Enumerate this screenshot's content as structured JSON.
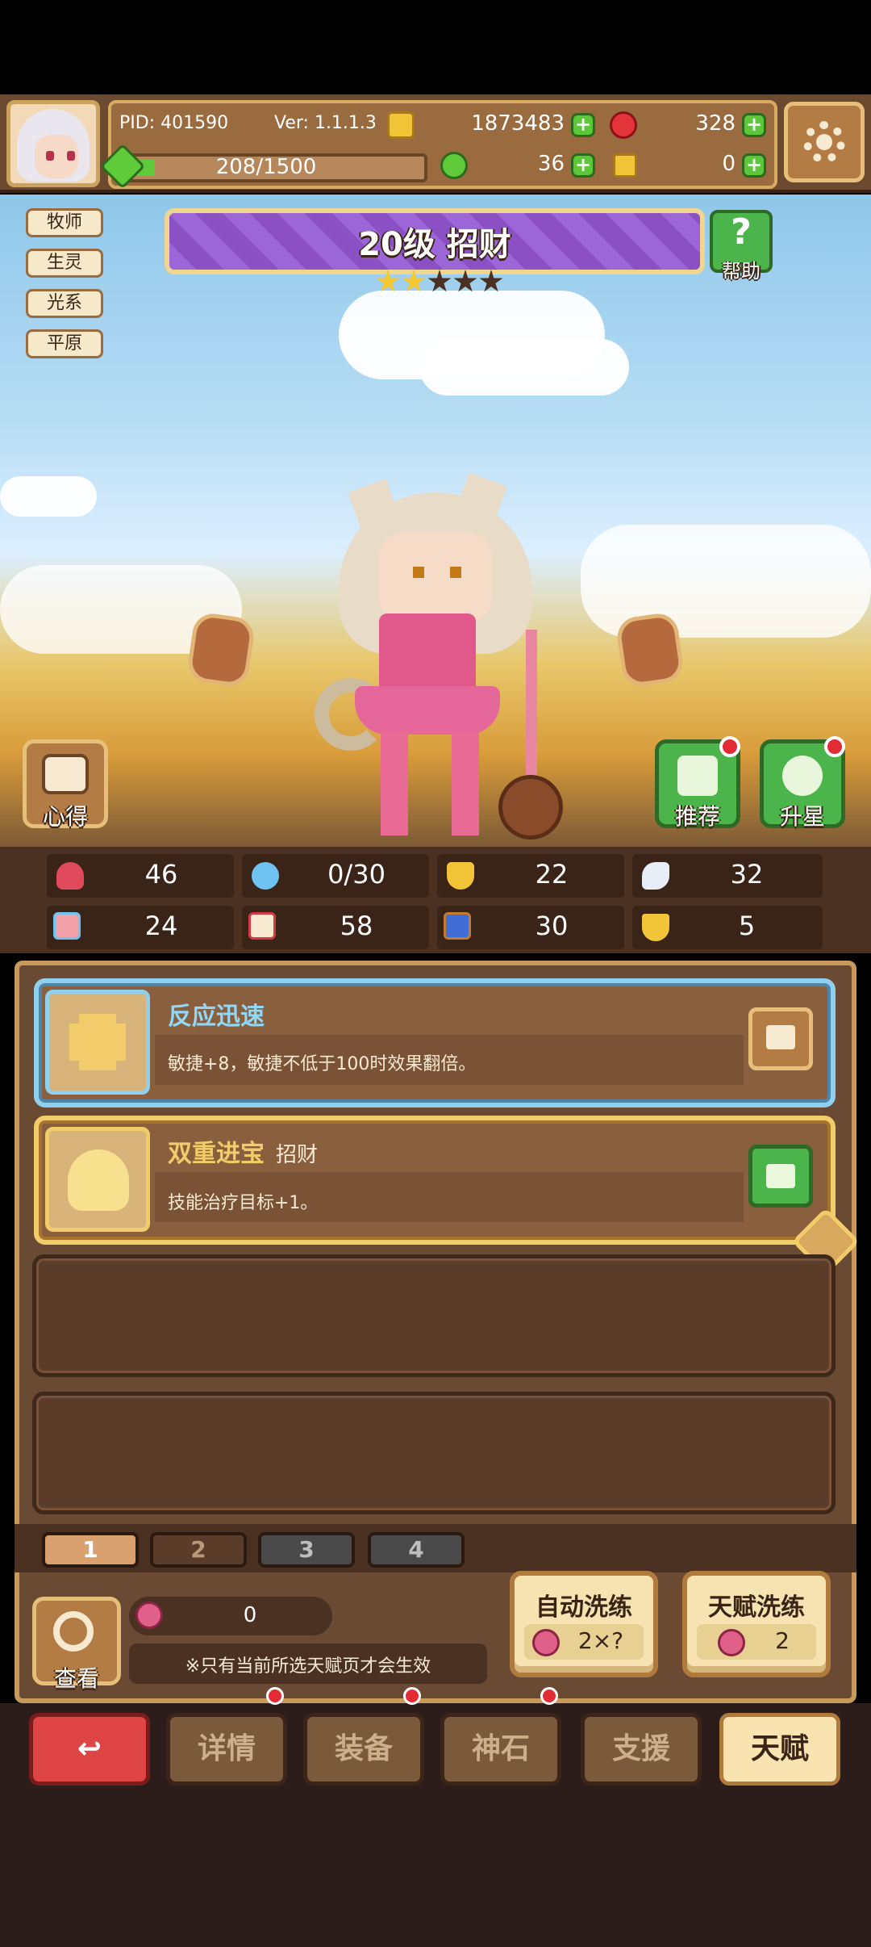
{
  "header": {
    "pid": "PID: 401590",
    "version": "Ver: 1.1.1.3",
    "gold": "1873483",
    "gems": "328",
    "exp": "208/1500",
    "exp_fraction": 0.139,
    "clovers": "36",
    "keys": "0"
  },
  "hero": {
    "tags": [
      "牧师",
      "生灵",
      "光系",
      "平原"
    ],
    "title": "20级 招财",
    "stars_filled": 2,
    "stars_total": 5,
    "help_label": "帮助",
    "insight_label": "心得",
    "recommend_label": "推荐",
    "upgrade_star_label": "升星"
  },
  "stats": {
    "hp": "46",
    "mana": "0/30",
    "defense": "22",
    "speed": "32",
    "strength": "24",
    "intelligence": "58",
    "agility": "30",
    "luck": "5"
  },
  "talents": [
    {
      "name": "反应迅速",
      "source": "",
      "desc": "敏捷+8，敏捷不低于100时效果翻倍。",
      "locked": false
    },
    {
      "name": "双重进宝",
      "source": "招财",
      "desc": "技能治疗目标+1。",
      "locked": true
    }
  ],
  "pages": [
    "1",
    "2",
    "3",
    "4"
  ],
  "active_page": "1",
  "bottom": {
    "view_label": "查看",
    "fruit_count": "0",
    "notice": "※只有当前所选天赋页才会生效",
    "auto_wash_title": "自动洗练",
    "auto_wash_cost": "2×?",
    "talent_wash_title": "天赋洗练",
    "talent_wash_cost": "2"
  },
  "nav": {
    "details": "详情",
    "equipment": "装备",
    "godstone": "神石",
    "support": "支援",
    "talent": "天赋"
  },
  "colors": {
    "panel_brown": "#6b4a33",
    "gold_border": "#f2cc6a",
    "blue_border": "#8fd0ee",
    "green_button": "#4bb44a",
    "red_button": "#e04545"
  }
}
